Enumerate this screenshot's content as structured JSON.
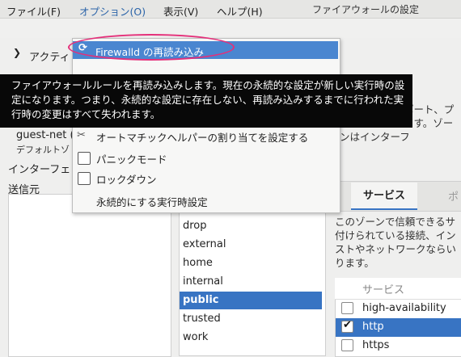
{
  "window": {
    "title": "ファイアウォールの設定"
  },
  "menubar": {
    "file": "ファイル(F)",
    "options": "オプション(O)",
    "view": "表示(V)",
    "help": "ヘルプ(H)"
  },
  "left": {
    "active_bindings": "アクティ",
    "connection_name": "guest-net (",
    "connection_zone": "デフォルトゾ",
    "interfaces": "インターフェ",
    "sources": "送信元"
  },
  "zones": [
    "drop",
    "external",
    "home",
    "internal",
    "public",
    "trusted",
    "work"
  ],
  "selected_zone": "public",
  "zone_description": "るネットワー ポート、プロトコル、マ ます。ゾーンはインターフ",
  "tabs": {
    "prev": "(",
    "services": "サービス",
    "ports": "ポ"
  },
  "services_description": "このゾーンで信頼できるサ 付けられている接続、イン ストやネットワークならい ります。",
  "services_table": {
    "header": "サービス",
    "rows": [
      {
        "name": "high-availability",
        "checked": false
      },
      {
        "name": "http",
        "checked": true
      },
      {
        "name": "https",
        "checked": false
      }
    ]
  },
  "options_menu": {
    "reload": "Firewalld の再読み込み",
    "reload_icon": "refresh-icon",
    "helper": "オートマチックヘルパーの割り当てを設定する",
    "helper_icon": "tools-icon",
    "panic": "パニックモード",
    "lockdown": "ロックダウン",
    "runtime_to_permanent": "永続的にする実行時設定"
  },
  "tooltip": "ファイアウォールルールを再読み込みします。現在の永続的な設定が新しい実行時の設定になります。つまり、永続的な設定に存在しない、再読み込みするまでに行われた実行時の変更はすべて失われます。",
  "colors": {
    "accent": "#3874c3",
    "menu_highlight": "#4a86d0",
    "annotation": "#e4307a",
    "tooltip_bg": "#080808"
  }
}
